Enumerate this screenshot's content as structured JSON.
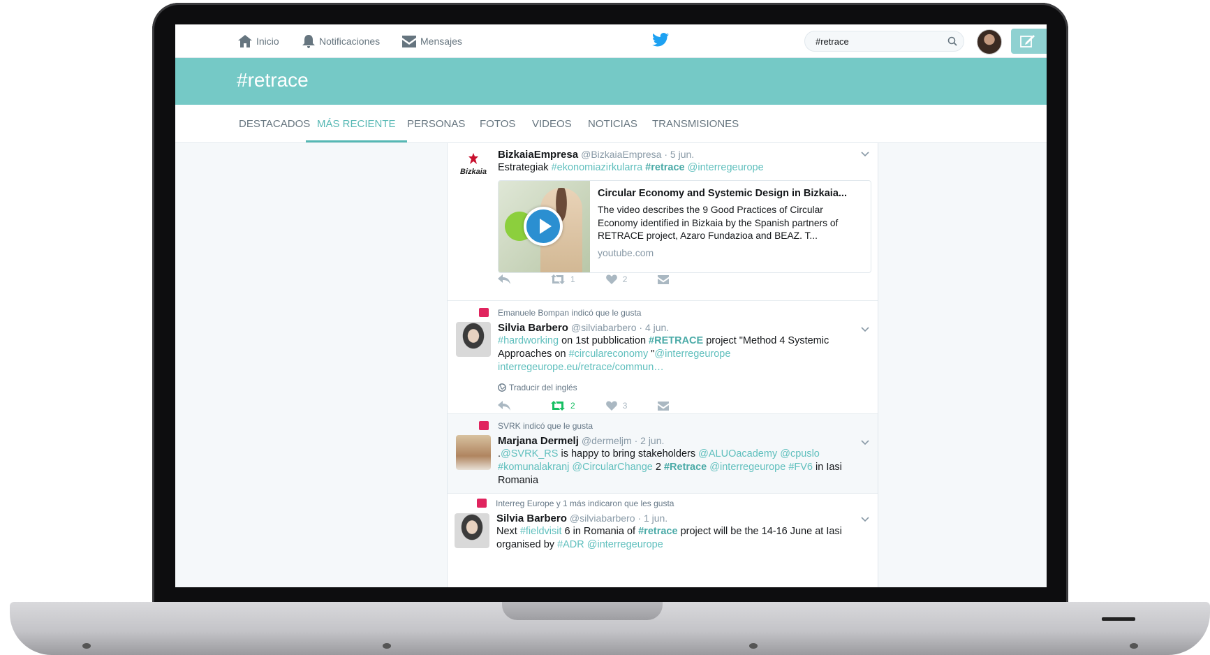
{
  "nav": {
    "home": "Inicio",
    "notifications": "Notificaciones",
    "messages": "Mensajes"
  },
  "search": {
    "value": "#retrace"
  },
  "banner": {
    "title": "#retrace"
  },
  "tabs": [
    {
      "label": "DESTACADOS"
    },
    {
      "label": "MÁS RECIENTE",
      "active": true
    },
    {
      "label": "PERSONAS"
    },
    {
      "label": "FOTOS"
    },
    {
      "label": "VIDEOS"
    },
    {
      "label": "NOTICIAS"
    },
    {
      "label": "TRANSMISIONES"
    }
  ],
  "tweets": [
    {
      "name": "BizkaiaEmpresa",
      "meta": "@BizkaiaEmpresa · 5 jun.",
      "logo_text": "Bizkaia",
      "text_prefix": "Estrategiak",
      "link1": "#ekonomiazirkularra",
      "hashtag": "#retrace",
      "link2": "@interregeurope",
      "card": {
        "title": "Circular Economy and Systemic Design in Bizkaia...",
        "description": "The video describes the 9 Good Practices of Circular Economy identified in Bizkaia by the Spanish partners of RETRACE project, Azaro Fundazioa and BEAZ. T...",
        "domain": "youtube.com"
      },
      "retweets": "1",
      "likes": "2"
    },
    {
      "social": "Emanuele Bompan indicó que le gusta",
      "name": "Silvia Barbero",
      "meta": "@silviabarbero · 4 jun.",
      "line1_a": "#hardworking",
      "line1_b": " on 1st pubblication ",
      "line1_c": "#RETRACE",
      "line1_d": " project \"Method 4 Systemic",
      "line2_a": "Approaches on ",
      "line2_b": "#circulareconomy",
      "line2_c": " \"",
      "line2_d": "@interregeurope",
      "line3": "interregeurope.eu/retrace/commun…",
      "translate": "Traducir del inglés",
      "retweets": "2",
      "likes": "3"
    },
    {
      "social": "SVRK indicó que le gusta",
      "name": "Marjana Dermelj",
      "meta": "@dermeljm · 2 jun.",
      "line1_a": ".",
      "line1_b": "@SVRK_RS",
      "line1_c": " is happy to bring stakeholders ",
      "line1_d": "@ALUOacademy @cpuslo",
      "line2_a": "#komunalakranj @CircularChange",
      "line2_b": " 2 ",
      "line2_c": "#Retrace",
      "line2_d": " ",
      "line2_e": "@interregeurope #FV6",
      "line2_f": " in Iasi",
      "line3": "Romania"
    },
    {
      "social": "Interreg Europe y 1 más indicaron que les gusta",
      "name": "Silvia Barbero",
      "meta": "@silviabarbero · 1 jun.",
      "line1_a": "Next ",
      "line1_b": "#fieldvisit",
      "line1_c": " 6 in Romania of ",
      "line1_d": "#retrace",
      "line1_e": " project will be the 14-16 June at Iasi",
      "line2_a": "organised by ",
      "line2_b": "#ADR @interregeurope"
    }
  ],
  "colors": {
    "accent": "#75c9c6",
    "link": "#5fbfbd",
    "like_badge": "#e0245e",
    "retweet_active": "#17bf63"
  }
}
